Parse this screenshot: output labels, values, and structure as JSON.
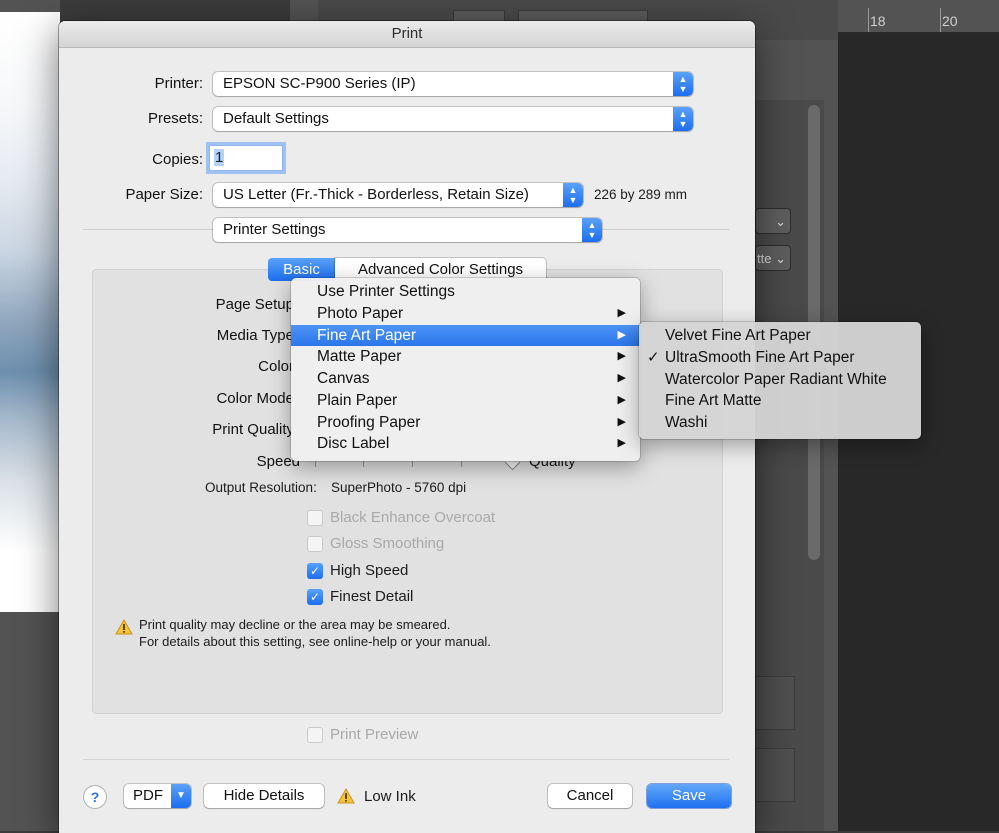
{
  "window": {
    "title": "Print"
  },
  "printer": {
    "label": "Printer:",
    "value": "EPSON SC-P900 Series (IP)"
  },
  "presets": {
    "label": "Presets:",
    "value": "Default Settings"
  },
  "copies": {
    "label": "Copies:",
    "value": "1"
  },
  "paper_size": {
    "label": "Paper Size:",
    "value": "US Letter (Fr.-Thick - Borderless, Retain Size)",
    "dimensions": "226 by 289 mm"
  },
  "section": {
    "value": "Printer Settings"
  },
  "tabs": [
    {
      "label": "Basic",
      "selected": true
    },
    {
      "label": "Advanced Color Settings",
      "selected": false
    }
  ],
  "settings_labels": {
    "page_setup": "Page Setup",
    "media_type": "Media Type",
    "color": "Color",
    "color_mode": "Color Mode",
    "print_quality": "Print Quality",
    "speed": "Speed",
    "quality": "Quality"
  },
  "output_resolution": {
    "label": "Output Resolution:",
    "value": "SuperPhoto - 5760 dpi"
  },
  "checkboxes": [
    {
      "label": "Black Enhance Overcoat",
      "checked": false,
      "enabled": false
    },
    {
      "label": "Gloss Smoothing",
      "checked": false,
      "enabled": false
    },
    {
      "label": "High Speed",
      "checked": true,
      "enabled": true
    },
    {
      "label": "Finest Detail",
      "checked": true,
      "enabled": true
    }
  ],
  "warning": {
    "icon": "warning-icon",
    "line1": "Print quality may decline or the area may be smeared.",
    "line2": "For details about this setting, see online-help or your manual."
  },
  "print_preview": {
    "label": "Print Preview",
    "checked": false,
    "enabled": false
  },
  "footer": {
    "help": "?",
    "pdf": "PDF",
    "hide_details": "Hide Details",
    "ink_status": "Low Ink",
    "cancel": "Cancel",
    "save": "Save"
  },
  "media_menu": {
    "items": [
      {
        "label": "Use Printer Settings",
        "submenu": false,
        "highlighted": false
      },
      {
        "label": "Photo Paper",
        "submenu": true,
        "highlighted": false
      },
      {
        "label": "Fine Art Paper",
        "submenu": true,
        "highlighted": true
      },
      {
        "label": "Matte Paper",
        "submenu": true,
        "highlighted": false
      },
      {
        "label": "Canvas",
        "submenu": true,
        "highlighted": false
      },
      {
        "label": "Plain Paper",
        "submenu": true,
        "highlighted": false
      },
      {
        "label": "Proofing Paper",
        "submenu": true,
        "highlighted": false
      },
      {
        "label": "Disc Label",
        "submenu": true,
        "highlighted": false
      }
    ]
  },
  "fine_art_submenu": {
    "items": [
      {
        "label": "Velvet Fine Art Paper",
        "checked": false
      },
      {
        "label": "UltraSmooth Fine Art Paper",
        "checked": true
      },
      {
        "label": "Watercolor Paper Radiant White",
        "checked": false
      },
      {
        "label": "Fine Art Matte",
        "checked": false
      },
      {
        "label": "Washi",
        "checked": false
      }
    ]
  },
  "background": {
    "ruler_ticks": [
      "18",
      "20"
    ],
    "panel_select_2": "tte"
  },
  "colors": {
    "accent": "#2a76ec",
    "dialog_bg": "#ececec",
    "app_bg": "#535353"
  }
}
